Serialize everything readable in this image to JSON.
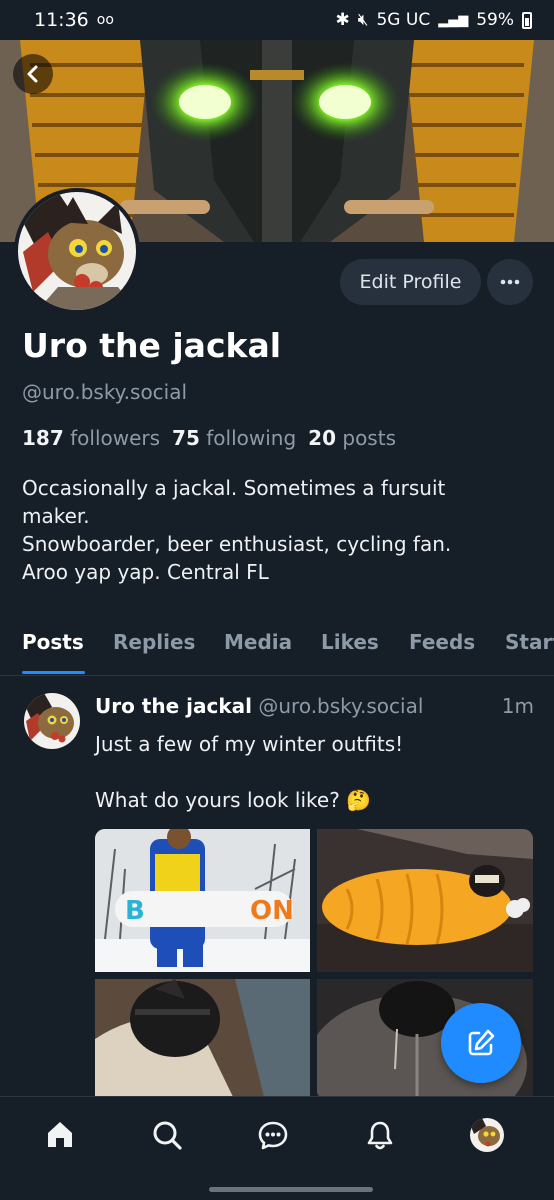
{
  "status_bar": {
    "time": "11:36",
    "network": "5G UC",
    "battery": "59%"
  },
  "profile": {
    "display_name": "Uro the jackal",
    "handle": "@uro.bsky.social",
    "edit_profile_label": "Edit Profile",
    "stats": {
      "followers_count": "187",
      "followers_label": "followers",
      "following_count": "75",
      "following_label": "following",
      "posts_count": "20",
      "posts_label": "posts"
    },
    "bio_lines": [
      "Occasionally a jackal. Sometimes a fursuit",
      "maker.",
      "Snowboarder, beer enthusiast, cycling fan.",
      "Aroo yap yap. Central FL"
    ]
  },
  "tabs": [
    {
      "label": "Posts",
      "active": true
    },
    {
      "label": "Replies",
      "active": false
    },
    {
      "label": "Media",
      "active": false
    },
    {
      "label": "Likes",
      "active": false
    },
    {
      "label": "Feeds",
      "active": false
    },
    {
      "label": "Start",
      "active": false
    }
  ],
  "post": {
    "author_name": "Uro the jackal",
    "author_handle": "@uro.bsky.social",
    "time": "1m",
    "text_line1": "Just a few of my winter outfits!",
    "text_line2": "What do yours look like? 🤔",
    "images": [
      "snowboarder",
      "orange-jacket",
      "hood-mask",
      "grey-hoodie"
    ]
  },
  "bottom_nav": [
    "home-icon",
    "search-icon",
    "chat-icon",
    "bell-icon",
    "profile-avatar"
  ],
  "colors": {
    "background": "#161e27",
    "accent": "#208bfe",
    "muted_text": "#8d9aa8",
    "button_bg": "#26313d"
  }
}
